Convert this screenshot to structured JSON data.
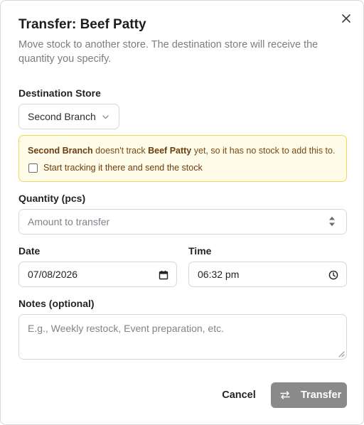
{
  "dialog": {
    "title": "Transfer: Beef Patty",
    "subtitle": "Move stock to another store. The destination store will receive the quantity you specify."
  },
  "destination": {
    "label": "Destination Store",
    "selected": "Second Branch"
  },
  "warning": {
    "store": "Second Branch",
    "text1": " doesn't track ",
    "item": "Beef Patty",
    "text2": " yet, so it has no stock to add this to.",
    "checkbox_label": "Start tracking it there and send the stock",
    "checkbox_checked": false,
    "border_color": "#f4d45a",
    "background_color": "#fefbe8"
  },
  "quantity": {
    "label": "Quantity (pcs)",
    "placeholder": "Amount to transfer"
  },
  "date": {
    "label": "Date",
    "value": "07/08/2026"
  },
  "time": {
    "label": "Time",
    "value": "06:32 pm"
  },
  "notes": {
    "label": "Notes (optional)",
    "placeholder": "E.g., Weekly restock, Event preparation, etc."
  },
  "actions": {
    "cancel": "Cancel",
    "transfer": "Transfer",
    "transfer_color": "#8a8a8a"
  },
  "icons": [
    "close-icon",
    "chevron-down-icon",
    "stepper-icon",
    "calendar-icon",
    "clock-icon",
    "swap-arrows-icon",
    "resize-handle-icon"
  ]
}
